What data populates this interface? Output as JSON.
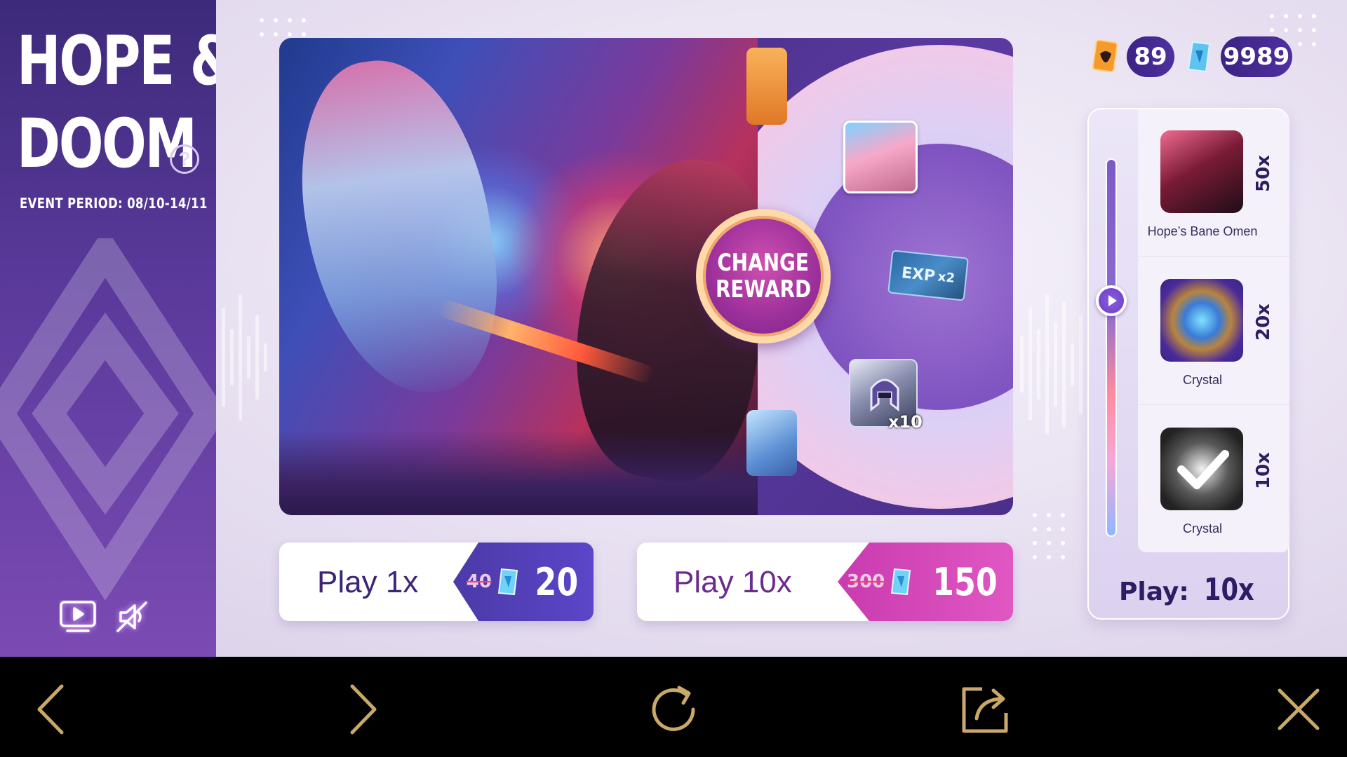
{
  "event": {
    "title_line1": "HOPE &",
    "title_line2": "DOOM",
    "help_symbol": "?",
    "period": "EVENT PERIOD: 08/10-14/11"
  },
  "banner": {
    "change_reward_line1": "CHANGE",
    "change_reward_line2": "REWARD",
    "rewards": [
      {
        "name": "hero-skin-portrait-icon"
      },
      {
        "name": "exp-card-icon",
        "label": "EXP",
        "multiplier": "x2"
      },
      {
        "name": "helmet-icon",
        "count": "x10"
      }
    ]
  },
  "currency": {
    "tickets": "89",
    "gems": "9989"
  },
  "play_buttons": {
    "single": {
      "label": "Play 1x",
      "old_price": "40",
      "price": "20",
      "color": "#5b46c8"
    },
    "multi": {
      "label": "Play 10x",
      "old_price": "300",
      "price": "150",
      "color": "#e057c2"
    }
  },
  "tiers": [
    {
      "name": "Hope’s Bane Omen",
      "count": "50x"
    },
    {
      "name": "Crystal",
      "count": "20x"
    },
    {
      "name": "Crystal",
      "count": "10x"
    }
  ],
  "play_selector": {
    "label": "Play:",
    "value": "10x",
    "level_fraction": 0.62
  },
  "colors": {
    "accent": "#5b3a9c",
    "pink": "#e057c2",
    "gold_icons": "#c9a86a"
  }
}
